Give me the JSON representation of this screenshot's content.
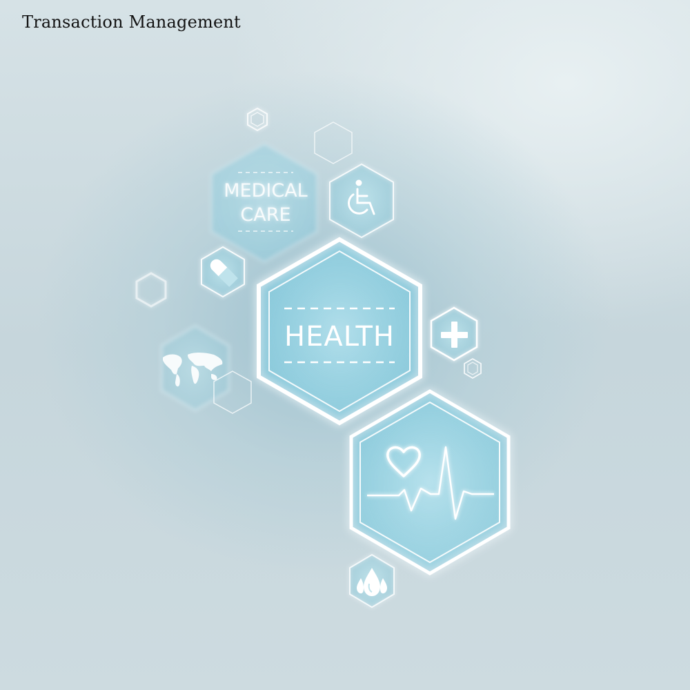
{
  "header": {
    "title": "Transaction Management"
  },
  "graphic": {
    "labels": {
      "medical": "MEDICAL",
      "care": "CARE",
      "health": "HEALTH"
    },
    "icons": [
      "wheelchair-icon",
      "pill-icon",
      "plus-icon",
      "world-map-icon",
      "heart-icon",
      "heartbeat-line-icon",
      "water-drops-icon"
    ],
    "colors": {
      "glow": "#7fd9ee",
      "line": "#ffffff",
      "hex_fill": "#a8d3df"
    }
  }
}
